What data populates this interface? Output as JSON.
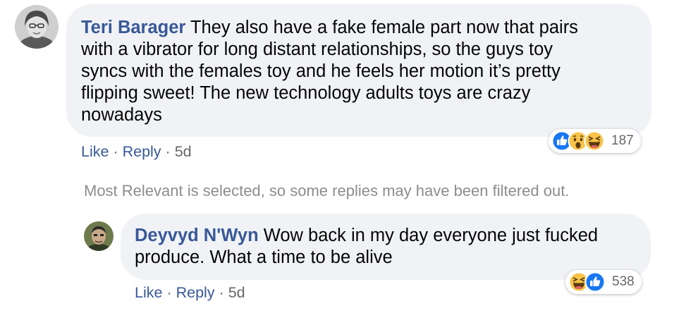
{
  "comments": [
    {
      "author": "Teri Barager",
      "text_lines": [
        "They also have a fake female part now that pairs",
        "with a vibrator for long distant relationships, so the guys toy",
        "syncs with the females toy and he feels her motion it’s pretty",
        "flipping sweet! The new technology adults toys are crazy",
        "nowadays"
      ],
      "actions": {
        "like": "Like",
        "reply": "Reply",
        "age": "5d"
      },
      "reactions": {
        "icons": [
          "like-icon",
          "wow-icon",
          "haha-icon"
        ],
        "count": "187"
      }
    }
  ],
  "filter_note": "Most Relevant is selected, so some replies may have been filtered out.",
  "replies": [
    {
      "author": "Deyvyd N'Wyn",
      "text_lines": [
        "Wow back in my day everyone just fucked",
        "produce. What a time to be alive"
      ],
      "actions": {
        "like": "Like",
        "reply": "Reply",
        "age": "5d"
      },
      "reactions": {
        "icons": [
          "haha-icon",
          "like-icon"
        ],
        "count": "538"
      }
    }
  ],
  "separator": "·",
  "colors": {
    "link": "#385898",
    "bubble": "#f0f2f5",
    "meta": "#65676b",
    "like_blue": "#1877f2",
    "emoji_yellow": "#f7c34a"
  }
}
